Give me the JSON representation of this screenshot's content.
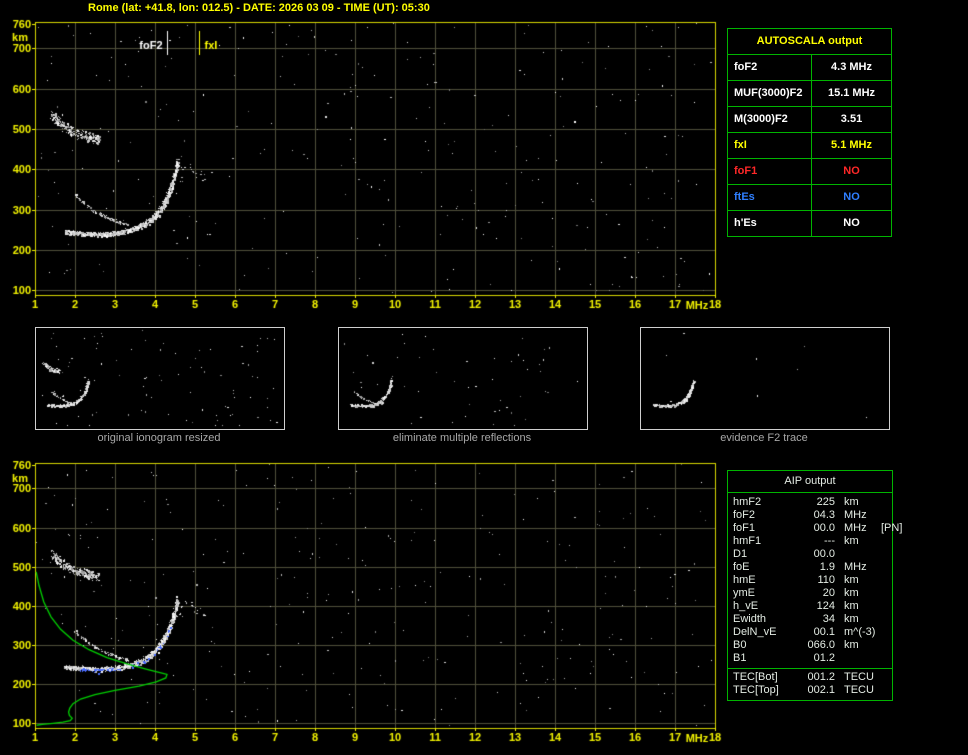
{
  "app": {
    "title": "Rome (lat: +41.8, lon: 012.5) - DATE: 2026 03 09 - TIME (UT): 05:30"
  },
  "colors": {
    "background": "#000000",
    "axis_label": "#f2f200",
    "plot_border": "#d8d800",
    "grid": "#50503a",
    "table_border": "#00b400",
    "white": "#ffffff",
    "yellow": "#ffff00",
    "red": "#ff2828",
    "blue": "#2f7fff",
    "green_profile": "#00d000",
    "fitted_blue": "#4a6cff",
    "caption_gray": "#a8a8a8",
    "aip_text": "#e4ece4"
  },
  "chart_data": [
    {
      "id": "top-ionogram",
      "type": "scatter",
      "title": "ionogram with autoscaled characteristics",
      "xlabel": "MHz",
      "ylabel": "km",
      "xlim": [
        1,
        18
      ],
      "ylim": [
        88,
        765
      ],
      "xticks": [
        1,
        2,
        3,
        4,
        5,
        6,
        7,
        8,
        9,
        10,
        11,
        12,
        13,
        14,
        15,
        16,
        17,
        18
      ],
      "yticks": [
        760,
        700,
        600,
        500,
        400,
        300,
        200,
        100
      ],
      "ygrid": [
        100,
        200,
        300,
        400,
        500,
        600,
        700
      ],
      "grid": true,
      "markers": [
        {
          "label": "foF2",
          "freq_mhz": 4.3,
          "color": "#ffffff",
          "label_side": "left"
        },
        {
          "label": "fxI",
          "freq_mhz": 5.1,
          "color": "#ffff00",
          "label_side": "right"
        }
      ],
      "noise_dots": 290,
      "seed": 7
    },
    {
      "id": "bottom-ionogram",
      "type": "scatter",
      "title": "ionogram with restored electron density profile",
      "xlabel": "MHz",
      "ylabel": "km",
      "xlim": [
        1,
        18
      ],
      "ylim": [
        88,
        765
      ],
      "xticks": [
        1,
        2,
        3,
        4,
        5,
        6,
        7,
        8,
        9,
        10,
        11,
        12,
        13,
        14,
        15,
        16,
        17,
        18
      ],
      "yticks": [
        760,
        700,
        600,
        500,
        400,
        300,
        200,
        100
      ],
      "ygrid": [
        100,
        200,
        300,
        400,
        500,
        600,
        700
      ],
      "grid": true,
      "has_profile": true,
      "noise_dots": 290,
      "seed": 13
    }
  ],
  "ionogram_traces": {
    "f2_trace": [
      [
        1.75,
        244
      ],
      [
        2.05,
        241
      ],
      [
        2.35,
        239
      ],
      [
        2.65,
        238
      ],
      [
        2.95,
        240
      ],
      [
        3.2,
        244
      ],
      [
        3.45,
        251
      ],
      [
        3.7,
        261
      ],
      [
        3.9,
        274
      ],
      [
        4.05,
        289
      ],
      [
        4.2,
        308
      ],
      [
        4.32,
        332
      ],
      [
        4.42,
        358
      ],
      [
        4.49,
        382
      ],
      [
        4.54,
        402
      ],
      [
        4.57,
        413
      ]
    ],
    "secondary_arc": [
      [
        2.0,
        336
      ],
      [
        2.25,
        313
      ],
      [
        2.5,
        295
      ],
      [
        2.8,
        279
      ],
      [
        3.1,
        268
      ],
      [
        3.35,
        261
      ]
    ],
    "second_hop_patch": [
      [
        1.42,
        534
      ],
      [
        1.62,
        514
      ],
      [
        1.85,
        498
      ],
      [
        2.1,
        486
      ],
      [
        2.35,
        478
      ],
      [
        2.6,
        473
      ]
    ],
    "extra_echoes": [
      [
        4.64,
        372
      ],
      [
        4.72,
        400
      ],
      [
        4.85,
        406
      ],
      [
        4.97,
        396
      ],
      [
        5.08,
        387
      ],
      [
        4.6,
        422
      ],
      [
        5.2,
        380
      ]
    ],
    "profile_nh": [
      [
        1.03,
        487
      ],
      [
        1.1,
        452
      ],
      [
        1.22,
        410
      ],
      [
        1.4,
        372
      ],
      [
        1.64,
        340
      ],
      [
        1.95,
        312
      ],
      [
        2.35,
        288
      ],
      [
        2.8,
        268
      ],
      [
        3.3,
        252
      ],
      [
        3.8,
        238
      ],
      [
        4.15,
        229
      ],
      [
        4.3,
        225
      ],
      [
        4.27,
        216
      ],
      [
        4.03,
        206
      ],
      [
        3.6,
        195
      ],
      [
        3.0,
        184
      ],
      [
        2.5,
        173
      ],
      [
        2.14,
        162
      ],
      [
        1.95,
        150
      ],
      [
        1.87,
        139
      ],
      [
        1.84,
        129
      ],
      [
        1.86,
        120
      ],
      [
        1.93,
        113
      ],
      [
        1.88,
        107
      ],
      [
        1.7,
        103
      ],
      [
        1.45,
        100
      ],
      [
        1.18,
        97
      ],
      [
        1.04,
        95
      ]
    ],
    "fitted_points": {
      "f_range": [
        2.05,
        4.45
      ],
      "offset_km": -4,
      "count": 60
    }
  },
  "autoscala": {
    "title": "AUTOSCALA output",
    "rows": [
      {
        "label": "foF2",
        "value": "4.3 MHz",
        "color": "#ffffff"
      },
      {
        "label": "MUF(3000)F2",
        "value": "15.1 MHz",
        "color": "#ffffff"
      },
      {
        "label": "M(3000)F2",
        "value": "3.51",
        "color": "#ffffff"
      },
      {
        "label": "fxI",
        "value": "5.1 MHz",
        "color": "#ffff00"
      },
      {
        "label": "foF1",
        "value": "NO",
        "color": "#ff2828"
      },
      {
        "label": "ftEs",
        "value": "NO",
        "color": "#2f7fff"
      },
      {
        "label": "h'Es",
        "value": "NO",
        "color": "#ffffff"
      }
    ]
  },
  "thumbnails": [
    {
      "caption": "original ionogram resized",
      "noise": 90,
      "show_patch": true,
      "show_secondary": true,
      "density": 330
    },
    {
      "caption": "eliminate multiple reflections",
      "noise": 50,
      "show_patch": false,
      "show_secondary": true,
      "density": 310
    },
    {
      "caption": "evidence F2 trace",
      "noise": 8,
      "show_patch": false,
      "show_secondary": false,
      "density": 270
    }
  ],
  "aip": {
    "title": "AIP output",
    "rows": [
      {
        "name": "hmF2",
        "value": "225",
        "unit": "km",
        "note": ""
      },
      {
        "name": "foF2",
        "value": "04.3",
        "unit": "MHz",
        "note": ""
      },
      {
        "name": "foF1",
        "value": "00.0",
        "unit": "MHz",
        "note": "[PN]"
      },
      {
        "name": "hmF1",
        "value": "---",
        "unit": "km",
        "note": ""
      },
      {
        "name": "D1",
        "value": "00.0",
        "unit": "",
        "note": ""
      },
      {
        "name": "foE",
        "value": "1.9",
        "unit": "MHz",
        "note": ""
      },
      {
        "name": "hmE",
        "value": "110",
        "unit": "km",
        "note": ""
      },
      {
        "name": "ymE",
        "value": "20",
        "unit": "km",
        "note": ""
      },
      {
        "name": "h_vE",
        "value": "124",
        "unit": "km",
        "note": ""
      },
      {
        "name": "Ewidth",
        "value": "34",
        "unit": "km",
        "note": ""
      },
      {
        "name": "DelN_vE",
        "value": "00.1",
        "unit": "m^(-3)",
        "note": ""
      },
      {
        "name": "B0",
        "value": "066.0",
        "unit": "km",
        "note": ""
      },
      {
        "name": "B1",
        "value": "01.2",
        "unit": "",
        "note": ""
      }
    ],
    "tec_rows": [
      {
        "name": "TEC[Bot]",
        "value": "001.2",
        "unit": "TECU"
      },
      {
        "name": "TEC[Top]",
        "value": "002.1",
        "unit": "TECU"
      }
    ]
  }
}
